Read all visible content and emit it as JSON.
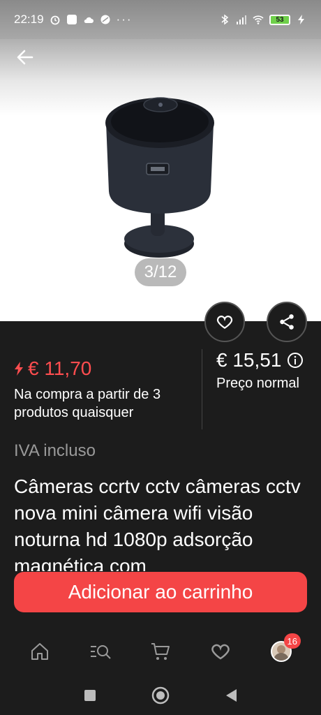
{
  "status_bar": {
    "time": "22:19",
    "battery": "53",
    "icons": [
      "alarm-icon",
      "app-icon",
      "cloud-icon",
      "data-saver-icon",
      "more-dots-icon",
      "bluetooth-icon",
      "signal-icon",
      "wifi-icon",
      "battery-icon",
      "charging-icon"
    ]
  },
  "gallery": {
    "counter": "3/12"
  },
  "price": {
    "sale": "€ 11,70",
    "sale_condition": "Na compra a partir de 3 produtos quaisquer",
    "normal": "€ 15,51",
    "normal_label": "Preço normal"
  },
  "vat_label": "IVA incluso",
  "product_title": "Câmeras ccrtv cctv câmeras cctv nova mini câmera wifi visão noturna hd 1080p adsorção magnética com",
  "cta": {
    "add_to_cart": "Adicionar ao carrinho"
  },
  "bottom_nav": {
    "items": [
      "home-icon",
      "search-categories-icon",
      "cart-icon",
      "wishlist-icon",
      "account-avatar"
    ],
    "badge": "16"
  },
  "colors": {
    "accent": "#f44546",
    "sale": "#ff4d4f",
    "background": "#1c1c1c"
  }
}
